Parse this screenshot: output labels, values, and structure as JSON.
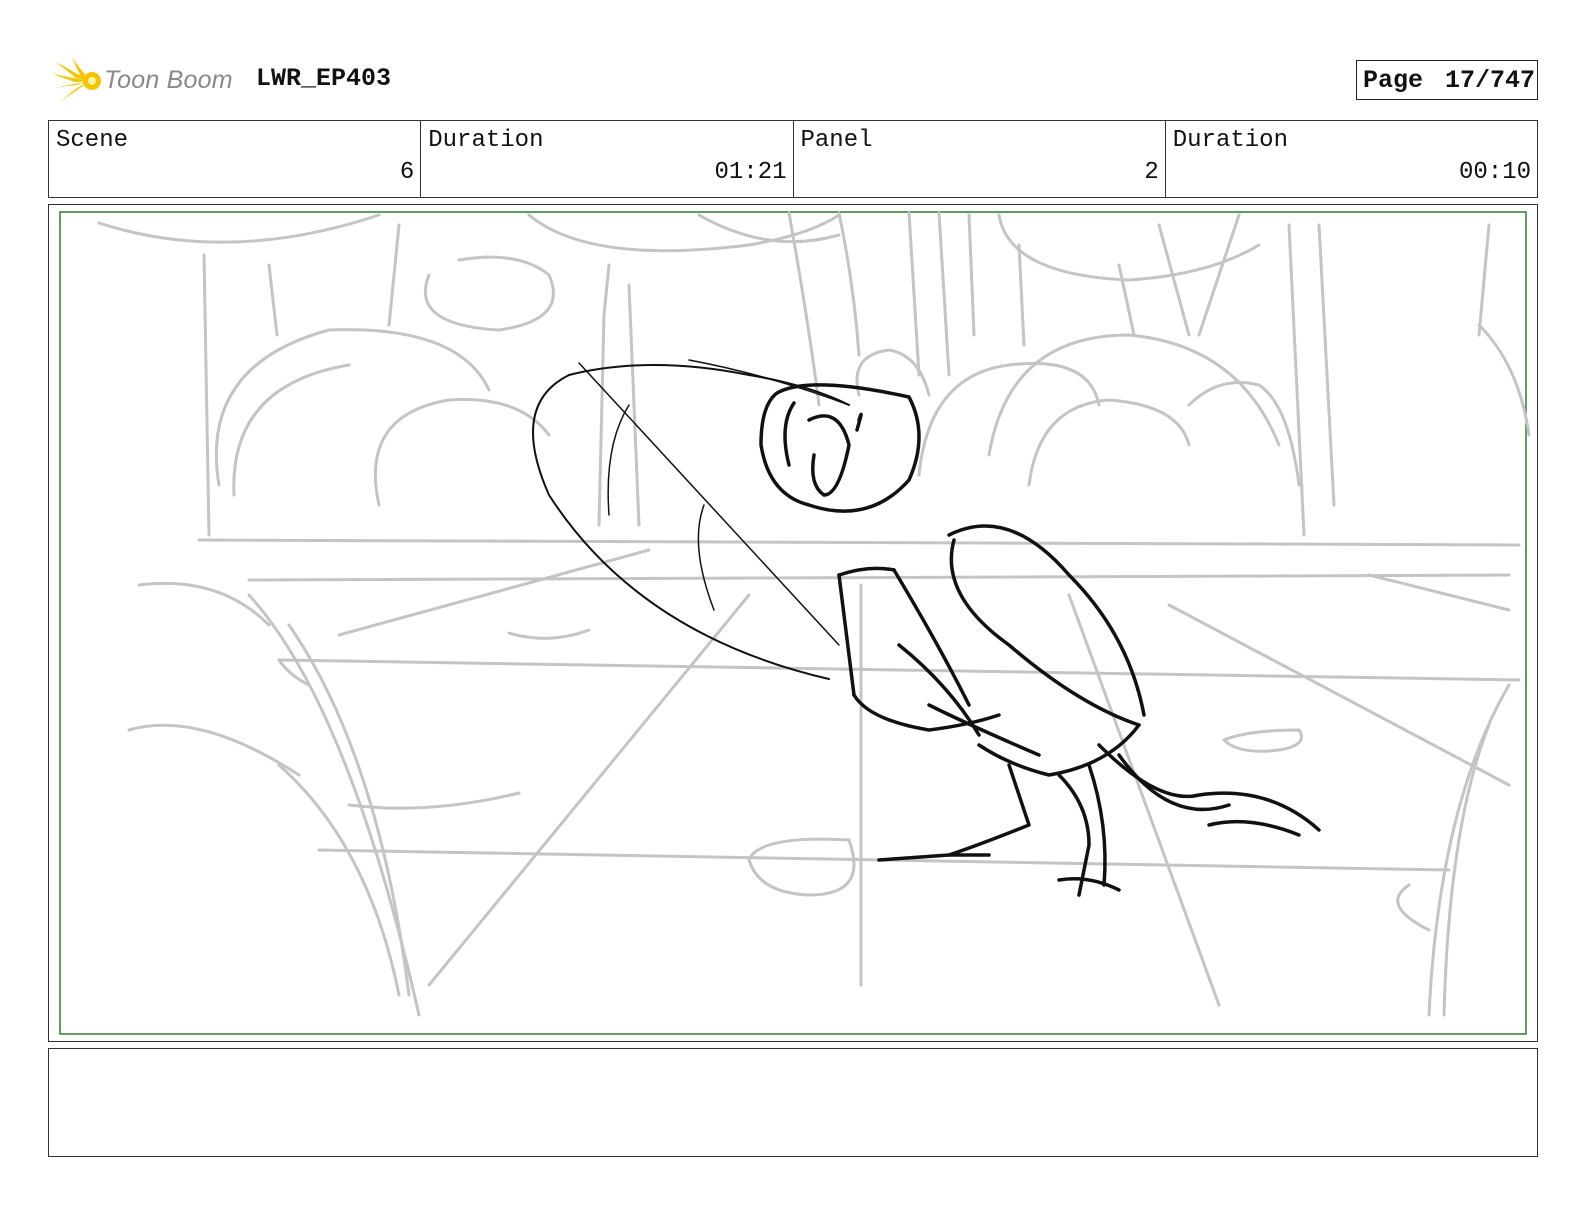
{
  "header": {
    "brand": "Toon Boom",
    "project": "LWR_EP403",
    "page_label": "Page",
    "page_value": "17/747"
  },
  "info": [
    {
      "label": "Scene",
      "value": "6"
    },
    {
      "label": "Duration",
      "value": "01:21"
    },
    {
      "label": "Panel",
      "value": "2"
    },
    {
      "label": "Duration",
      "value": "00:10"
    }
  ],
  "colors": {
    "safe_frame": "#2e7d32",
    "rough_lines": "#c4c4c4",
    "ink_lines": "#111111",
    "logo_star": "#f5c400"
  },
  "notes": {
    "dialogue": ""
  }
}
